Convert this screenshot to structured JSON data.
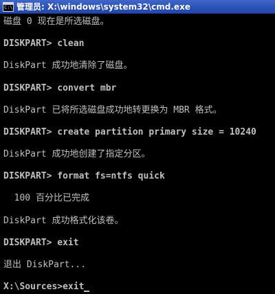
{
  "window": {
    "title": "管理员: X:\\windows\\system32\\cmd.exe",
    "icon": "cmd-window-icon"
  },
  "console": {
    "lines": [
      "磁盘 0 现在是所选磁盘。",
      "DISKPART> clean",
      "DiskPart 成功地清除了磁盘。",
      "DISKPART> convert mbr",
      "DiskPart 已将所选磁盘成功地转更换为 MBR 格式。",
      "DISKPART> create partition primary size = 10240",
      "DiskPart 成功地创建了指定分区。",
      "DISKPART> format fs=ntfs quick",
      "  100 百分比已完成",
      "DiskPart 成功格式化该卷。",
      "DISKPART> exit",
      "退出 DiskPart...",
      "X:\\Sources>exit"
    ]
  },
  "colors": {
    "background": "#000000",
    "text": "#c0c0c0",
    "titlebar": "#2c52b8"
  }
}
